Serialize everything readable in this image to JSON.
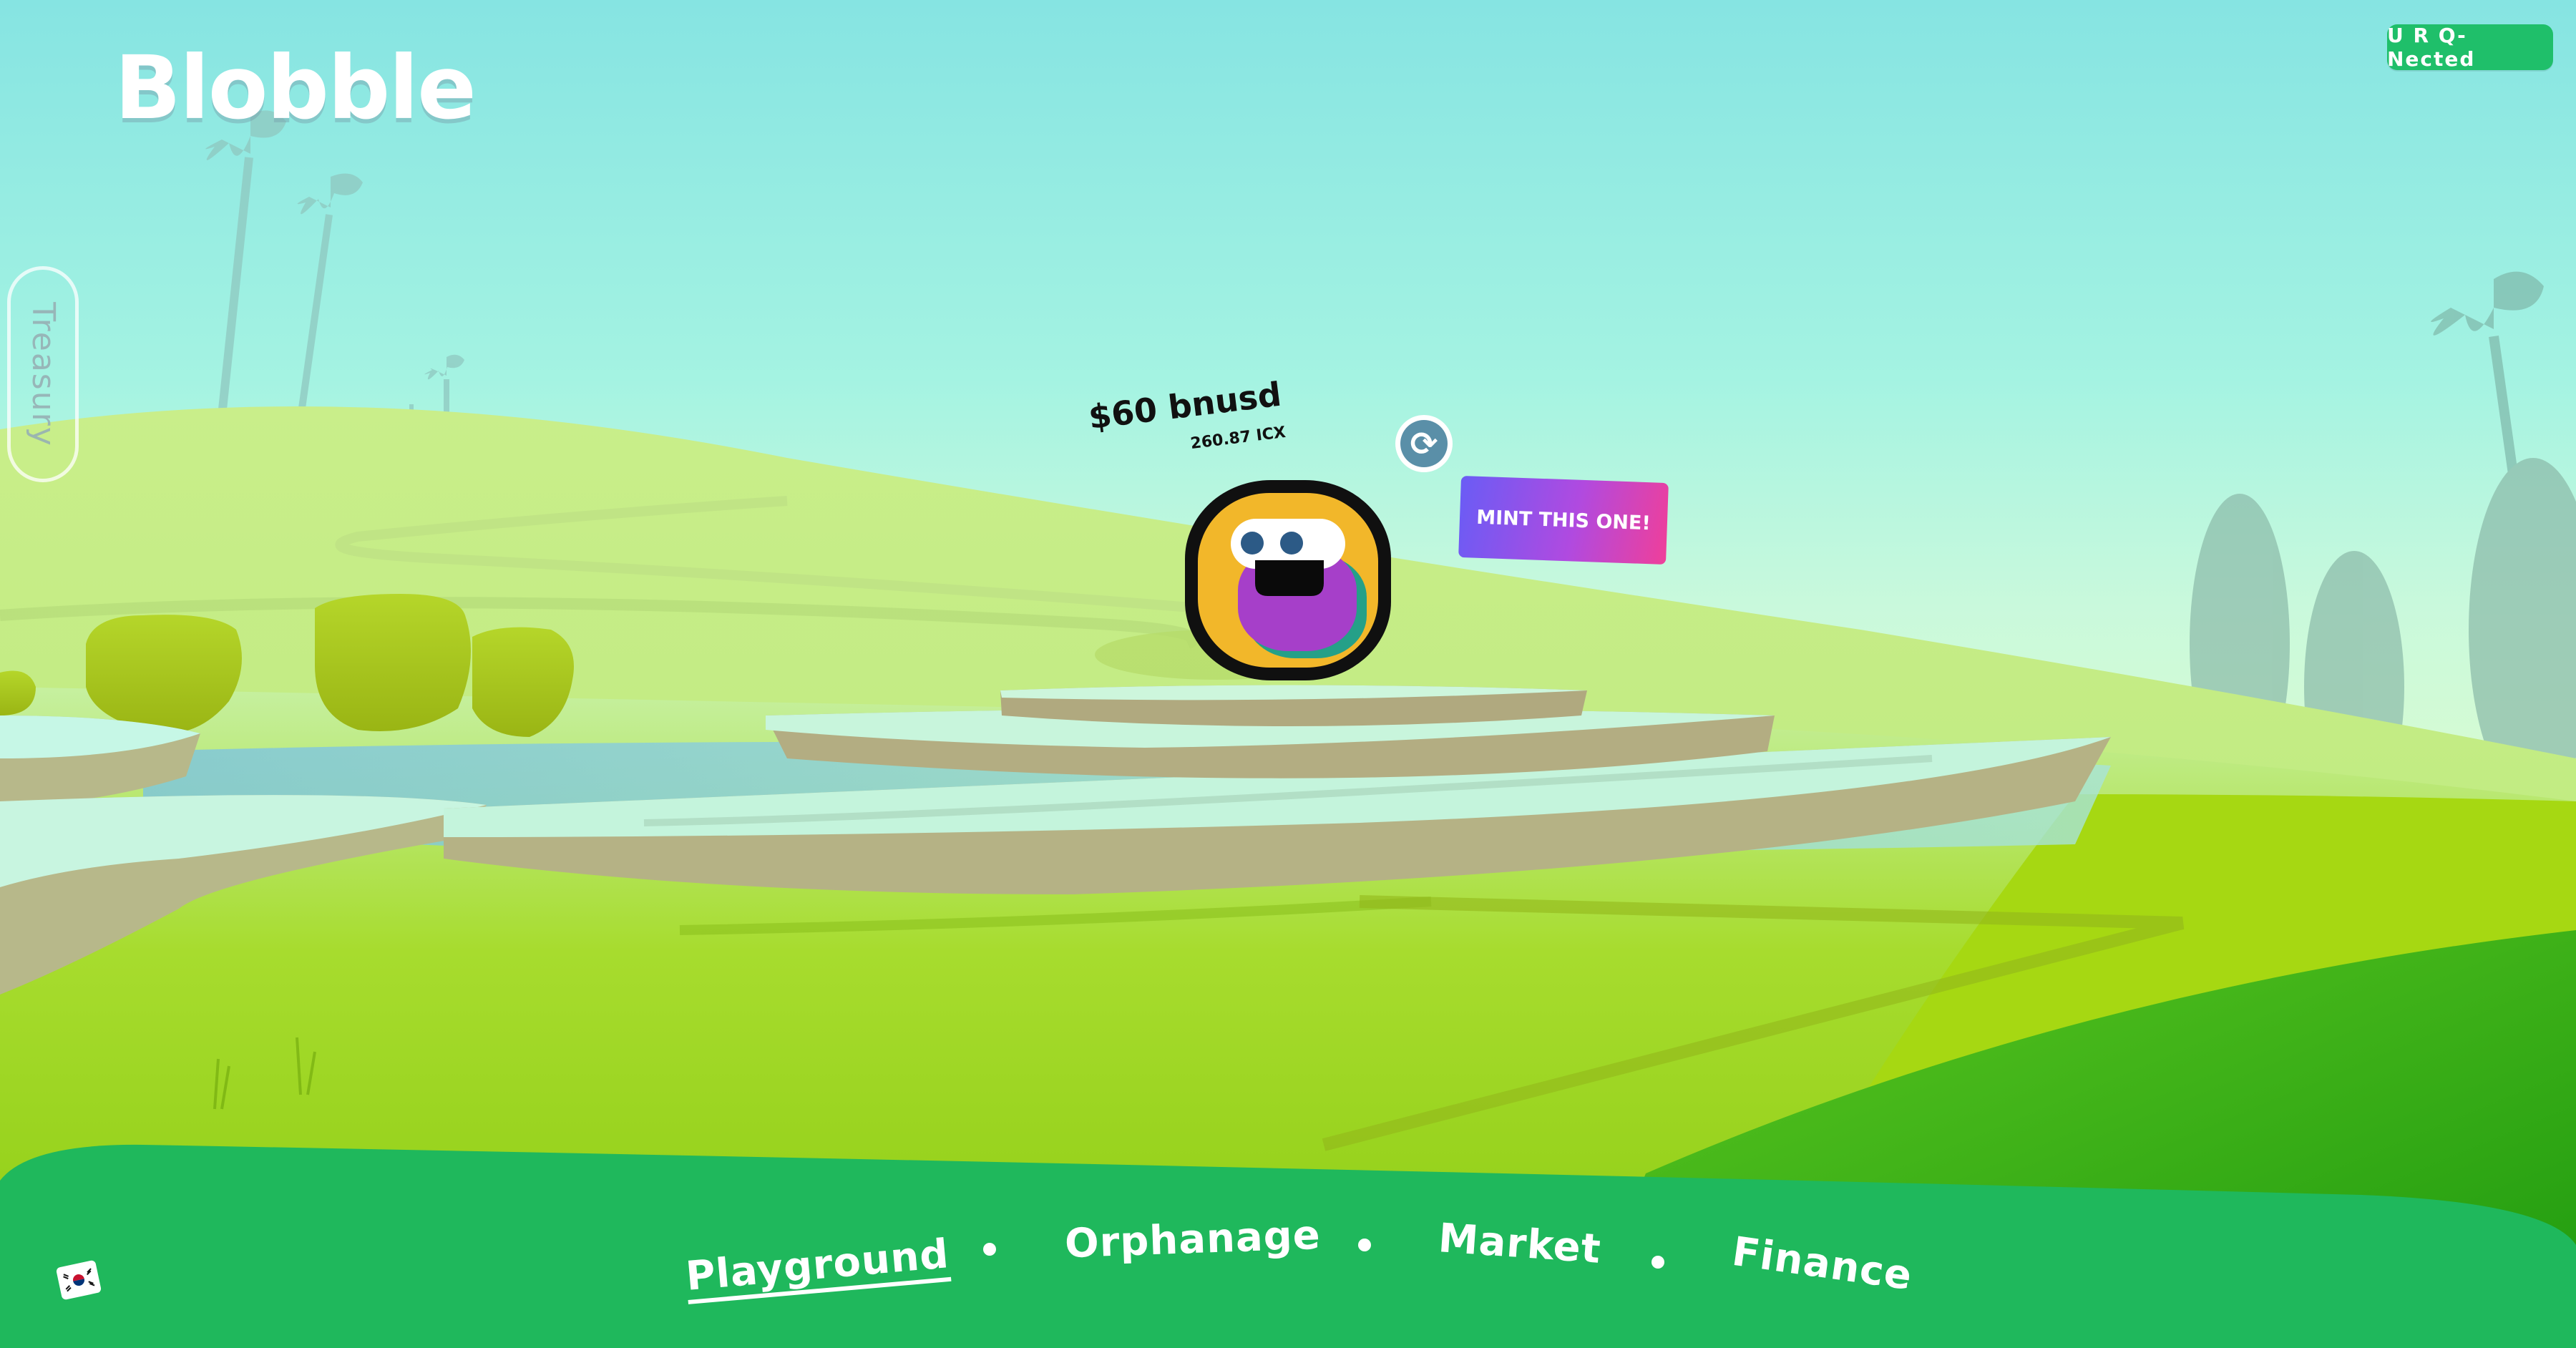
{
  "app": {
    "logo_text": "Blobble"
  },
  "header": {
    "connect_label": "U R Q-Nected"
  },
  "side_tab": {
    "treasury_label": "Treasury"
  },
  "blobble": {
    "price_label": "$60 bnusd",
    "icx_label": "260.87 ICX",
    "mint_label": "MINT THIS ONE!",
    "refresh_icon": "refresh-icon"
  },
  "nav": {
    "items": [
      {
        "label": "Playground",
        "active": true
      },
      {
        "label": "Orphanage",
        "active": false
      },
      {
        "label": "Market",
        "active": false
      },
      {
        "label": "Finance",
        "active": false
      }
    ]
  },
  "language": {
    "icon": "korea-flag-icon"
  },
  "colors": {
    "footer_green": "#1fb85c",
    "connect_green": "#1fbf6a",
    "mint_gradient_start": "#6a5cf5",
    "mint_gradient_end": "#ef3f9a",
    "blobble_body": "#f2b72a",
    "blobble_inner": "#a63fc9"
  }
}
